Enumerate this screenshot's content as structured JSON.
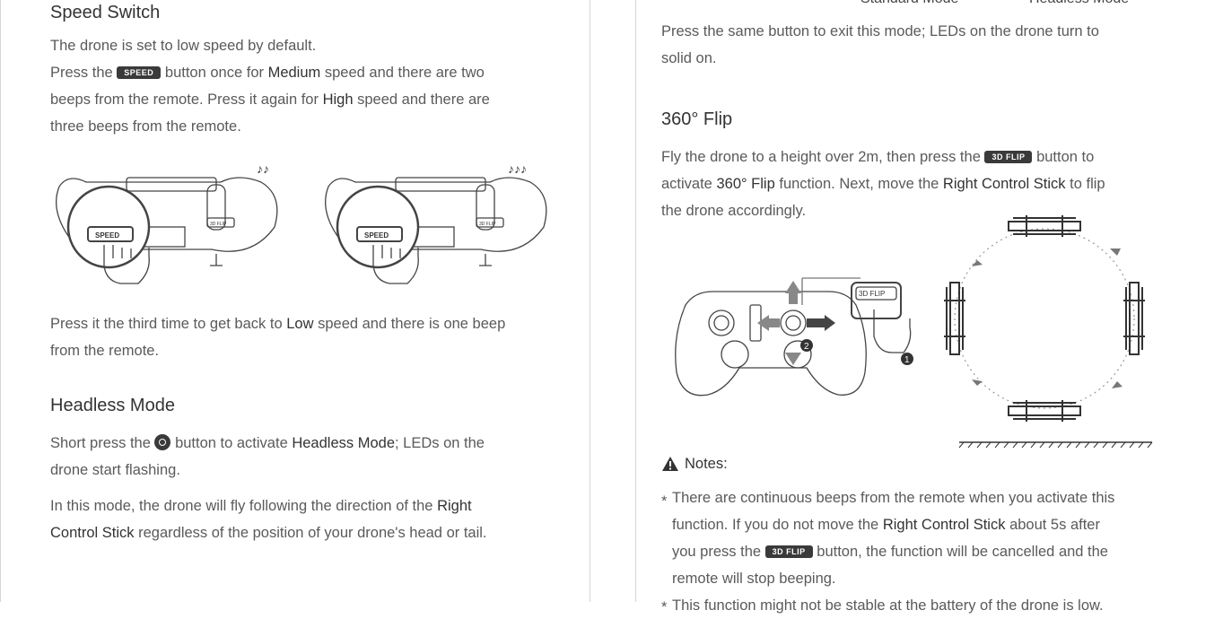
{
  "left": {
    "speed": {
      "title": "Speed Switch",
      "p1": "The drone is set to low speed by default.",
      "p2_a": "Press the",
      "p2_b": "button once for",
      "p2_medium": "Medium",
      "p2_c": "speed and there are two",
      "p3_a": "beeps from the remote. Press it again for",
      "p3_high": "High",
      "p3_b": "speed and there are",
      "p4": "three beeps from the remote.",
      "p5_a": "Press it the third time to get back to",
      "p5_low": "Low",
      "p5_b": "speed and there is one beep",
      "p6": "from the remote."
    },
    "headless": {
      "title": "Headless Mode",
      "p1_a": "Short press the",
      "p1_b": "button to activate",
      "p1_mode": "Headless Mode",
      "p1_c": "; LEDs on the",
      "p2": "drone start flashing.",
      "p3_a": "In this mode, the drone will fly following the direction of the",
      "p3_right": "Right",
      "p4_control": "Control Stick",
      "p4_b": "regardless of the position of your drone's head or tail."
    }
  },
  "right": {
    "top_labels": {
      "left": "Standard Mode",
      "right": "Headless Mode"
    },
    "exit_p1": "Press the same button to exit this mode; LEDs on the drone turn to",
    "exit_p2": "solid on.",
    "flip": {
      "title": "360° Flip",
      "p1_a": "Fly the drone to a height over 2m, then press the",
      "p1_b": "button to",
      "p2_a": "activate",
      "p2_flip": "360° Flip",
      "p2_b": "function. Next, move the",
      "p2_stick": "Right Control Stick",
      "p2_c": "to flip",
      "p3": "the drone accordingly."
    },
    "notes": {
      "title": "Notes:",
      "n1_l1": "There are continuous beeps from the remote when you activate this",
      "n1_l2_a": "function. If you do not move the",
      "n1_l2_stick": "Right Control Stick",
      "n1_l2_b": "about 5s after",
      "n1_l3_a": "you press the",
      "n1_l3_b": "button, the function will be cancelled and the",
      "n1_l4": "remote will stop beeping.",
      "n2_l1": "This function might not be stable at the battery of the drone is low."
    }
  },
  "labels": {
    "speed_btn": "SPEED",
    "flip_btn": "3D FLIP",
    "remote_flip_label": "3D FLIP",
    "remote_speed_label": "SPEED",
    "remote_3dflip_small": "3D FLIP",
    "step1": "1",
    "step2": "2"
  },
  "icons": {
    "headless_icon": "compass-icon",
    "warning_icon": "warning-icon",
    "beep_icon": "music-note-icon"
  }
}
